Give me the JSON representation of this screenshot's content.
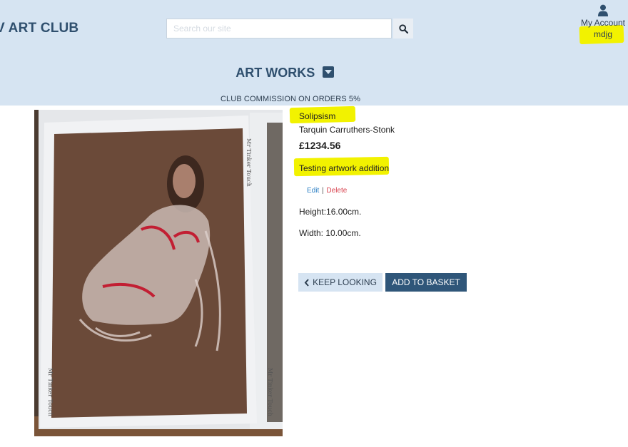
{
  "header": {
    "brand": "V ART CLUB",
    "search": {
      "placeholder": "Search our site",
      "value": ""
    },
    "account": {
      "label": "My Account",
      "username": "mdjg"
    },
    "nav_menu": {
      "label": "ART WORKS"
    },
    "commission": "CLUB COMMISSION ON ORDERS 5%"
  },
  "artwork": {
    "title": "Solipsism",
    "artist": "Tarquin Carruthers-Stonk",
    "price": "£1234.56",
    "description": "Testing artwork addition",
    "edit_label": "Edit",
    "separator": "|",
    "delete_label": "Delete",
    "height": "Height:16.00cm.",
    "width": "Width: 10.00cm.",
    "image_signature": "Mr Tinker Touch"
  },
  "buttons": {
    "keep_looking": "KEEP LOOKING",
    "add_to_basket": "ADD TO BASKET"
  },
  "colors": {
    "header_bg": "#d6e4f2",
    "brand": "#2f4f6e",
    "highlight": "#f2f200",
    "primary_button": "#2f5679",
    "edit_link": "#2c7fc4",
    "delete_link": "#d8434f"
  },
  "icons": {
    "search": "search-icon",
    "account": "user-icon",
    "dropdown": "caret-down-icon",
    "back": "chevron-left-icon"
  }
}
